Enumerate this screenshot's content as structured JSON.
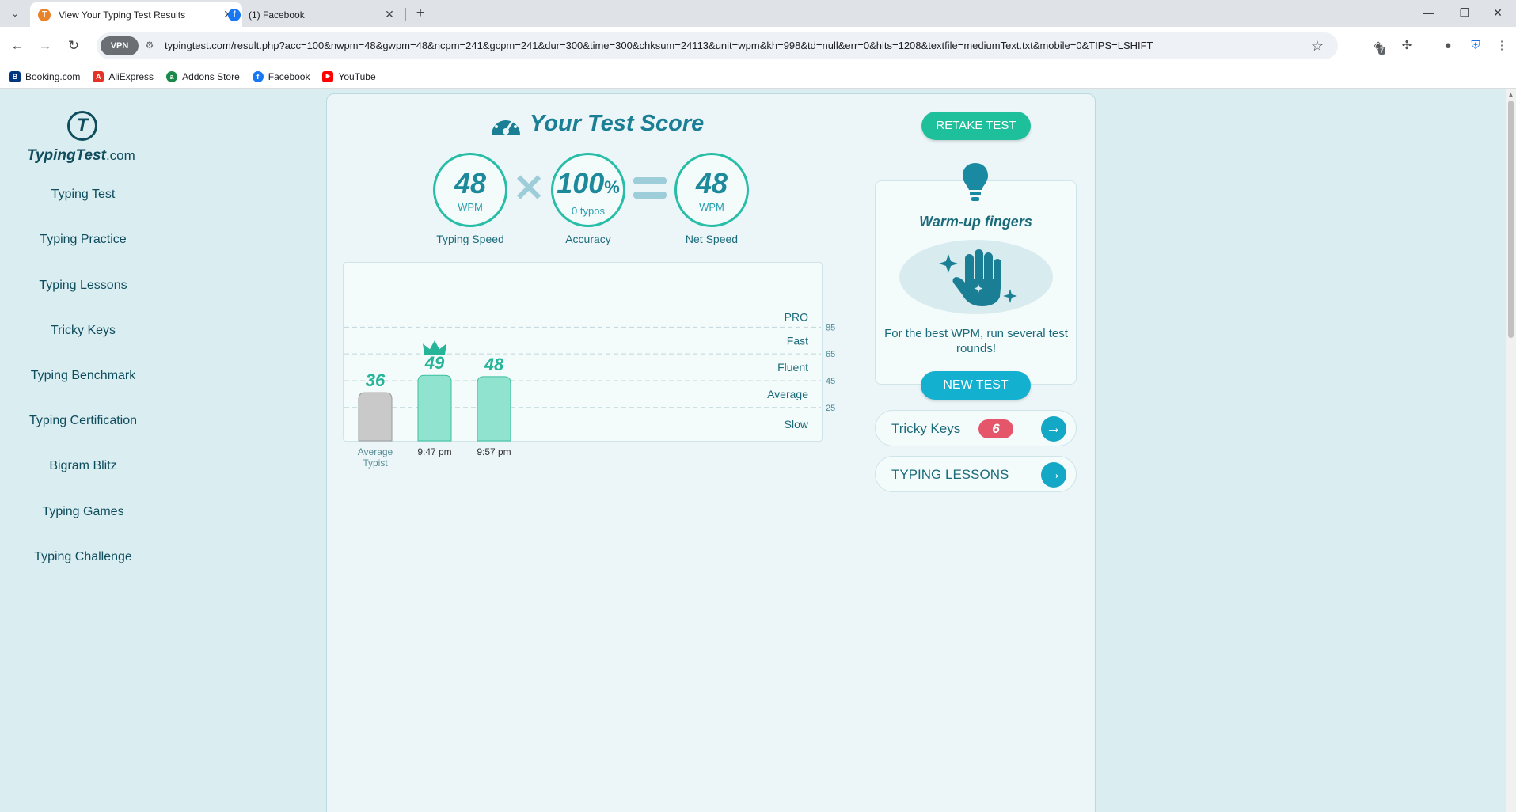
{
  "browser": {
    "tabs": [
      {
        "title": "View Your Typing Test Results",
        "close": "✕",
        "favicon_color": "#e8832a"
      },
      {
        "title": "(1) Facebook",
        "close": "✕",
        "favicon_color": "#1877f2"
      }
    ],
    "new_tab": "+",
    "url": "typingtest.com/result.php?acc=100&nwpm=48&gwpm=48&ncpm=241&gcpm=241&dur=300&time=300&chksum=24113&unit=wpm&kh=998&td=null&err=0&hits=1208&textfile=mediumText.txt&mobile=0&TIPS=LSHIFT",
    "vpn_label": "VPN",
    "extension_badge": "7",
    "bookmarks": [
      {
        "label": "Booking.com",
        "icon_text": "B",
        "color": "#003580"
      },
      {
        "label": "AliExpress",
        "icon_text": "A",
        "color": "#e43225"
      },
      {
        "label": "Addons Store",
        "icon_text": "a",
        "color": "#1a8a4a"
      },
      {
        "label": "Facebook",
        "icon_text": "f",
        "color": "#1877f2"
      },
      {
        "label": "YouTube",
        "icon_text": "▶",
        "color": "#ff0000"
      }
    ]
  },
  "logo": {
    "brand": "TypingTest",
    "domain": ".com",
    "mark": "T"
  },
  "nav": [
    "Typing Test",
    "Typing Practice",
    "Typing Lessons",
    "Tricky Keys",
    "Typing Benchmark",
    "Typing Certification",
    "Bigram Blitz",
    "Typing Games",
    "Typing Challenge"
  ],
  "score": {
    "title": "Your Test Score",
    "speed": {
      "value": "48",
      "unit": "WPM",
      "label": "Typing Speed"
    },
    "accuracy": {
      "value": "100",
      "pct": "%",
      "sub": "0 typos",
      "label": "Accuracy"
    },
    "net": {
      "value": "48",
      "unit": "WPM",
      "label": "Net Speed"
    },
    "times": "✕"
  },
  "retake_label": "RETAKE TEST",
  "chart_data": {
    "type": "bar",
    "categories": [
      "Average Typist",
      "9:47 pm",
      "9:57 pm"
    ],
    "values": [
      36,
      49,
      48
    ],
    "best_index": 1,
    "yticks": [
      25,
      45,
      65,
      85
    ],
    "ylim": [
      0,
      100
    ],
    "bands": [
      "PRO",
      "Fast",
      "Fluent",
      "Average",
      "Slow"
    ],
    "colors": {
      "average": "#c9c9c9",
      "user": "#8fe3cf",
      "label": "#27b59a"
    }
  },
  "tip": {
    "title": "Warm-up fingers",
    "text": "For the best WPM, run several test rounds!",
    "button": "NEW TEST"
  },
  "links": [
    {
      "label": "Tricky Keys",
      "badge": "6",
      "arrow": "→"
    },
    {
      "label": "TYPING LESSONS",
      "badge": "",
      "arrow": "→"
    }
  ]
}
